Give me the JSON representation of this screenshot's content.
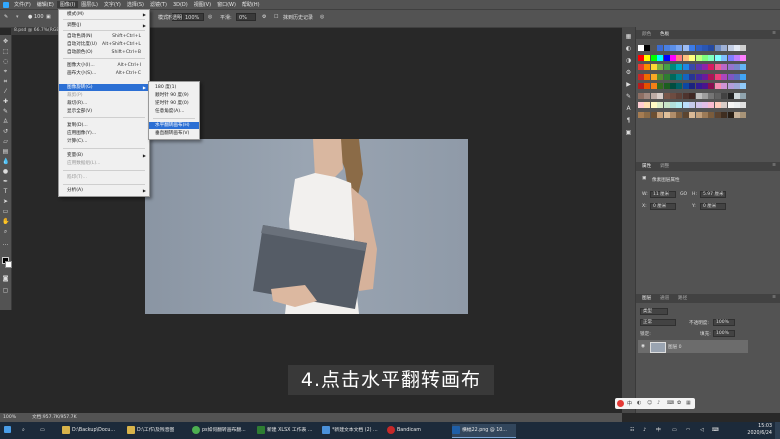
{
  "menubar": {
    "items": [
      "文件(F)",
      "编辑(E)",
      "图像(I)",
      "图层(L)",
      "文字(Y)",
      "选择(S)",
      "滤镜(T)",
      "3D(D)",
      "视图(V)",
      "窗口(W)",
      "帮助(H)"
    ]
  },
  "options": {
    "brush_size": "100",
    "mode_label": "模式:",
    "mode_value": "正常",
    "opacity_label": "不透明度:",
    "opacity_value": "100%",
    "flow_label": "流量:",
    "flow_value": "100%",
    "smooth_label": "平滑:",
    "smooth_value": "0%",
    "history_label": "抹到历史记录"
  },
  "doc_tab": "8.psd @ 66.7%(RGB/8)",
  "image_menu": [
    {
      "label": "模式(M)",
      "shortcut": "",
      "arrow": true,
      "disabled": false
    },
    {
      "sep": true
    },
    {
      "label": "调整(J)",
      "shortcut": "",
      "arrow": true,
      "disabled": false
    },
    {
      "sep": true
    },
    {
      "label": "自动色调(N)",
      "shortcut": "Shift+Ctrl+L",
      "arrow": false,
      "disabled": false
    },
    {
      "label": "自动对比度(U)",
      "shortcut": "Alt+Shift+Ctrl+L",
      "arrow": false,
      "disabled": false
    },
    {
      "label": "自动颜色(O)",
      "shortcut": "Shift+Ctrl+B",
      "arrow": false,
      "disabled": false
    },
    {
      "sep": true
    },
    {
      "label": "图像大小(I)...",
      "shortcut": "Alt+Ctrl+I",
      "arrow": false,
      "disabled": false
    },
    {
      "label": "画布大小(S)...",
      "shortcut": "Alt+Ctrl+C",
      "arrow": false,
      "disabled": false
    },
    {
      "label": "图像旋转(G)",
      "shortcut": "",
      "arrow": true,
      "disabled": false,
      "highlight": true
    },
    {
      "label": "裁剪(P)",
      "shortcut": "",
      "arrow": false,
      "disabled": true
    },
    {
      "label": "裁切(R)...",
      "shortcut": "",
      "arrow": false,
      "disabled": false
    },
    {
      "label": "显示全部(V)",
      "shortcut": "",
      "arrow": false,
      "disabled": false
    },
    {
      "sep": true
    },
    {
      "label": "复制(D)...",
      "shortcut": "",
      "arrow": false,
      "disabled": false
    },
    {
      "label": "应用图像(Y)...",
      "shortcut": "",
      "arrow": false,
      "disabled": false
    },
    {
      "label": "计算(C)...",
      "shortcut": "",
      "arrow": false,
      "disabled": false
    },
    {
      "sep": true
    },
    {
      "label": "变量(B)",
      "shortcut": "",
      "arrow": true,
      "disabled": false
    },
    {
      "label": "应用数据组(L)...",
      "shortcut": "",
      "arrow": false,
      "disabled": true
    },
    {
      "sep": true
    },
    {
      "label": "陷印(T)...",
      "shortcut": "",
      "arrow": false,
      "disabled": true
    },
    {
      "sep": true
    },
    {
      "label": "分析(A)",
      "shortcut": "",
      "arrow": true,
      "disabled": false
    }
  ],
  "rotate_menu": [
    {
      "label": "180 度(1)",
      "highlight": false
    },
    {
      "label": "顺时针 90 度(9)",
      "highlight": false
    },
    {
      "label": "逆时针 90 度(0)",
      "highlight": false
    },
    {
      "label": "任意角度(A)...",
      "highlight": false
    },
    {
      "sep": true
    },
    {
      "label": "水平翻转画布(H)",
      "highlight": true
    },
    {
      "label": "垂直翻转画布(V)",
      "highlight": false
    }
  ],
  "panels": {
    "color_tab": "颜色",
    "swatches_tab": "色板",
    "properties_tab": "属性",
    "adjust_tab": "调整",
    "props_title": "像素图层属性",
    "w_label": "W:",
    "w_value": "11 厘米",
    "go_label": "GO",
    "h_label": "H:",
    "h_value": "5.97 厘米",
    "x_label": "X:",
    "x_value": "0 厘米",
    "y_label": "Y:",
    "y_value": "0 厘米",
    "layers_tab": "图层",
    "channels_tab": "通道",
    "paths_tab": "路径",
    "kind_label": "类型",
    "blend_mode": "正常",
    "opacity_label": "不透明度:",
    "opacity_value": "100%",
    "lock_label": "锁定:",
    "fill_label": "填充:",
    "fill_value": "100%",
    "layer_name": "图层 0"
  },
  "status": {
    "zoom": "100%",
    "doc_info": "文档:957.7K/957.7K"
  },
  "caption": "4.点击水平翻转画布",
  "ime": {
    "label": "中"
  },
  "taskbar": {
    "items": [
      {
        "label": "D:\\Backup\\Docu...",
        "color": "#d8b34a"
      },
      {
        "label": "D:\\工作\\及残音图",
        "color": "#d8b34a"
      },
      {
        "label": "ps如何翻转画布翻...",
        "color": "#4caf50"
      },
      {
        "label": "新建 XLSX 工作表 ...",
        "color": "#2e7d32"
      },
      {
        "label": "*新建文本文档 (2) ...",
        "color": "#4a90d9"
      },
      {
        "label": "Bandicam",
        "color": "#c62828"
      },
      {
        "label": "横幅22.png @ 10...",
        "color": "#1f5fa8",
        "active": true
      }
    ],
    "time": "15:03",
    "date": "2020/6/24"
  },
  "colors": {
    "menu_highlight": "#2b6fd4",
    "ps_gray": "#535353",
    "canvas_bg": "#282828"
  }
}
